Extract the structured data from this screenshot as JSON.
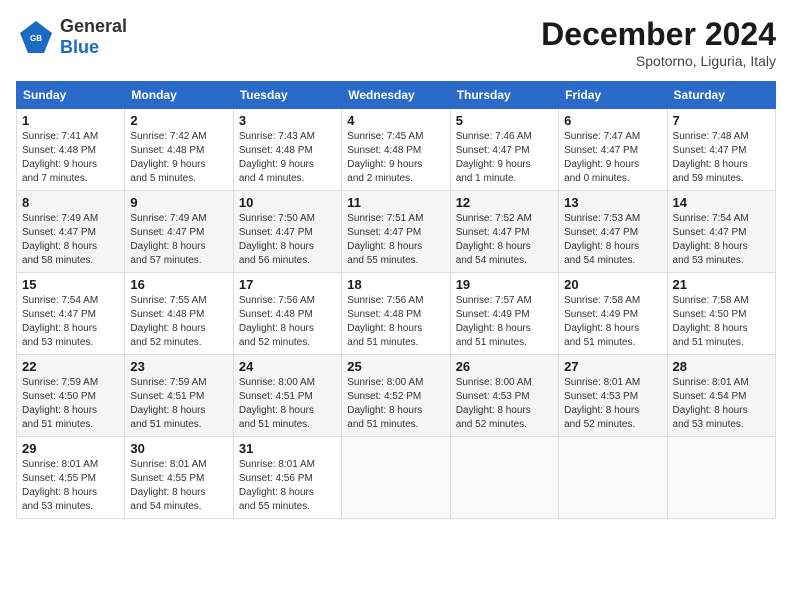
{
  "header": {
    "logo_general": "General",
    "logo_blue": "Blue",
    "title": "December 2024",
    "subtitle": "Spotorno, Liguria, Italy"
  },
  "days_of_week": [
    "Sunday",
    "Monday",
    "Tuesday",
    "Wednesday",
    "Thursday",
    "Friday",
    "Saturday"
  ],
  "weeks": [
    [
      {
        "day": "1",
        "info": "Sunrise: 7:41 AM\nSunset: 4:48 PM\nDaylight: 9 hours\nand 7 minutes."
      },
      {
        "day": "2",
        "info": "Sunrise: 7:42 AM\nSunset: 4:48 PM\nDaylight: 9 hours\nand 5 minutes."
      },
      {
        "day": "3",
        "info": "Sunrise: 7:43 AM\nSunset: 4:48 PM\nDaylight: 9 hours\nand 4 minutes."
      },
      {
        "day": "4",
        "info": "Sunrise: 7:45 AM\nSunset: 4:48 PM\nDaylight: 9 hours\nand 2 minutes."
      },
      {
        "day": "5",
        "info": "Sunrise: 7:46 AM\nSunset: 4:47 PM\nDaylight: 9 hours\nand 1 minute."
      },
      {
        "day": "6",
        "info": "Sunrise: 7:47 AM\nSunset: 4:47 PM\nDaylight: 9 hours\nand 0 minutes."
      },
      {
        "day": "7",
        "info": "Sunrise: 7:48 AM\nSunset: 4:47 PM\nDaylight: 8 hours\nand 59 minutes."
      }
    ],
    [
      {
        "day": "8",
        "info": "Sunrise: 7:49 AM\nSunset: 4:47 PM\nDaylight: 8 hours\nand 58 minutes."
      },
      {
        "day": "9",
        "info": "Sunrise: 7:49 AM\nSunset: 4:47 PM\nDaylight: 8 hours\nand 57 minutes."
      },
      {
        "day": "10",
        "info": "Sunrise: 7:50 AM\nSunset: 4:47 PM\nDaylight: 8 hours\nand 56 minutes."
      },
      {
        "day": "11",
        "info": "Sunrise: 7:51 AM\nSunset: 4:47 PM\nDaylight: 8 hours\nand 55 minutes."
      },
      {
        "day": "12",
        "info": "Sunrise: 7:52 AM\nSunset: 4:47 PM\nDaylight: 8 hours\nand 54 minutes."
      },
      {
        "day": "13",
        "info": "Sunrise: 7:53 AM\nSunset: 4:47 PM\nDaylight: 8 hours\nand 54 minutes."
      },
      {
        "day": "14",
        "info": "Sunrise: 7:54 AM\nSunset: 4:47 PM\nDaylight: 8 hours\nand 53 minutes."
      }
    ],
    [
      {
        "day": "15",
        "info": "Sunrise: 7:54 AM\nSunset: 4:47 PM\nDaylight: 8 hours\nand 53 minutes."
      },
      {
        "day": "16",
        "info": "Sunrise: 7:55 AM\nSunset: 4:48 PM\nDaylight: 8 hours\nand 52 minutes."
      },
      {
        "day": "17",
        "info": "Sunrise: 7:56 AM\nSunset: 4:48 PM\nDaylight: 8 hours\nand 52 minutes."
      },
      {
        "day": "18",
        "info": "Sunrise: 7:56 AM\nSunset: 4:48 PM\nDaylight: 8 hours\nand 51 minutes."
      },
      {
        "day": "19",
        "info": "Sunrise: 7:57 AM\nSunset: 4:49 PM\nDaylight: 8 hours\nand 51 minutes."
      },
      {
        "day": "20",
        "info": "Sunrise: 7:58 AM\nSunset: 4:49 PM\nDaylight: 8 hours\nand 51 minutes."
      },
      {
        "day": "21",
        "info": "Sunrise: 7:58 AM\nSunset: 4:50 PM\nDaylight: 8 hours\nand 51 minutes."
      }
    ],
    [
      {
        "day": "22",
        "info": "Sunrise: 7:59 AM\nSunset: 4:50 PM\nDaylight: 8 hours\nand 51 minutes."
      },
      {
        "day": "23",
        "info": "Sunrise: 7:59 AM\nSunset: 4:51 PM\nDaylight: 8 hours\nand 51 minutes."
      },
      {
        "day": "24",
        "info": "Sunrise: 8:00 AM\nSunset: 4:51 PM\nDaylight: 8 hours\nand 51 minutes."
      },
      {
        "day": "25",
        "info": "Sunrise: 8:00 AM\nSunset: 4:52 PM\nDaylight: 8 hours\nand 51 minutes."
      },
      {
        "day": "26",
        "info": "Sunrise: 8:00 AM\nSunset: 4:53 PM\nDaylight: 8 hours\nand 52 minutes."
      },
      {
        "day": "27",
        "info": "Sunrise: 8:01 AM\nSunset: 4:53 PM\nDaylight: 8 hours\nand 52 minutes."
      },
      {
        "day": "28",
        "info": "Sunrise: 8:01 AM\nSunset: 4:54 PM\nDaylight: 8 hours\nand 53 minutes."
      }
    ],
    [
      {
        "day": "29",
        "info": "Sunrise: 8:01 AM\nSunset: 4:55 PM\nDaylight: 8 hours\nand 53 minutes."
      },
      {
        "day": "30",
        "info": "Sunrise: 8:01 AM\nSunset: 4:55 PM\nDaylight: 8 hours\nand 54 minutes."
      },
      {
        "day": "31",
        "info": "Sunrise: 8:01 AM\nSunset: 4:56 PM\nDaylight: 8 hours\nand 55 minutes."
      },
      {
        "day": "",
        "info": ""
      },
      {
        "day": "",
        "info": ""
      },
      {
        "day": "",
        "info": ""
      },
      {
        "day": "",
        "info": ""
      }
    ]
  ]
}
